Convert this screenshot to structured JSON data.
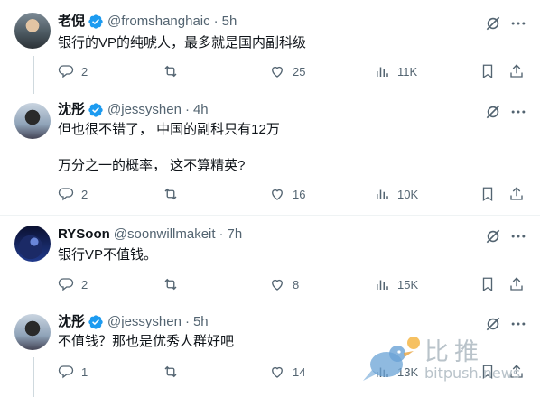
{
  "tweets": [
    {
      "name": "老倪",
      "verified": true,
      "handle": "@fromshanghaic",
      "time": "5h",
      "text": "银行的VP的纯唬人，最多就是国内副科级",
      "replies": "2",
      "retweets": "",
      "likes": "25",
      "views": "11K"
    },
    {
      "name": "沈彤",
      "verified": true,
      "handle": "@jessyshen",
      "time": "4h",
      "text": "但也很不错了， 中国的副科只有12万\n\n万分之一的概率， 这不算精英?",
      "replies": "2",
      "retweets": "",
      "likes": "16",
      "views": "10K"
    },
    {
      "name": "RYSoon",
      "verified": false,
      "handle": "@soonwillmakeit",
      "time": "7h",
      "text": "银行VP不值钱。",
      "replies": "2",
      "retweets": "",
      "likes": "8",
      "views": "15K"
    },
    {
      "name": "沈彤",
      "verified": true,
      "handle": "@jessyshen",
      "time": "5h",
      "text": "不值钱？那也是优秀人群好吧",
      "replies": "1",
      "retweets": "",
      "likes": "14",
      "views": "13K"
    }
  ],
  "separator": "·",
  "watermark": {
    "brand": "比推",
    "url": "bitpush.news"
  },
  "colors": {
    "verified": "#1d9bf0",
    "muted": "#536471",
    "text": "#0f1419"
  },
  "icons": [
    "grok-icon",
    "more-icon",
    "reply-icon",
    "retweet-icon",
    "like-icon",
    "views-icon",
    "bookmark-icon",
    "share-icon",
    "verified-badge-icon"
  ]
}
